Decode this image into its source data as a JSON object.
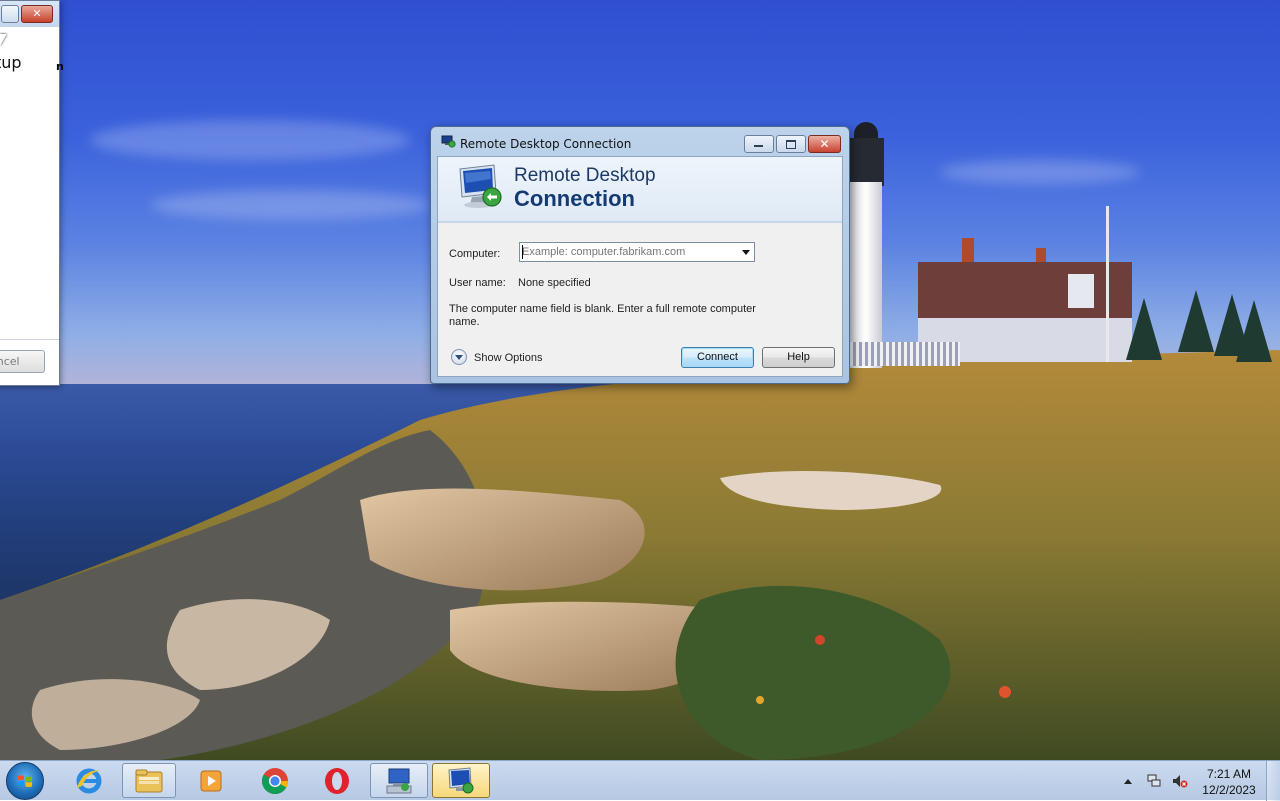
{
  "desktop": {
    "wallpaper": "lighthouse-coast-landscape"
  },
  "background_window": {
    "partial_title_text": "tup",
    "partial_cancel_label": "ancel",
    "partial_desktop_text": "n"
  },
  "dialog": {
    "title": "Remote Desktop Connection",
    "banner_line1": "Remote Desktop",
    "banner_line2": "Connection",
    "computer_label": "Computer:",
    "computer_value": "",
    "computer_placeholder": "Example: computer.fabrikam.com",
    "username_label": "User name:",
    "username_value": "None specified",
    "message": "The computer name field is blank. Enter a full remote computer name.",
    "show_options_label": "Show Options",
    "connect_label": "Connect",
    "help_label": "Help"
  },
  "taskbar": {
    "items": [
      {
        "name": "internet-explorer",
        "icon": "ie-icon"
      },
      {
        "name": "windows-explorer",
        "icon": "folder-icon"
      },
      {
        "name": "windows-media-player",
        "icon": "media-player-icon"
      },
      {
        "name": "google-chrome",
        "icon": "chrome-icon"
      },
      {
        "name": "opera",
        "icon": "opera-icon"
      },
      {
        "name": "remote-desktop-setup",
        "icon": "installer-icon"
      },
      {
        "name": "remote-desktop-connection",
        "icon": "rdc-icon"
      }
    ],
    "clock_time": "7:21 AM",
    "clock_date": "12/2/2023"
  },
  "colors": {
    "taskbar": "#bcd0ec",
    "dialog_frame": "#a9c4e2",
    "connect_button": "#bee2f9",
    "close_button": "#c8432f"
  }
}
